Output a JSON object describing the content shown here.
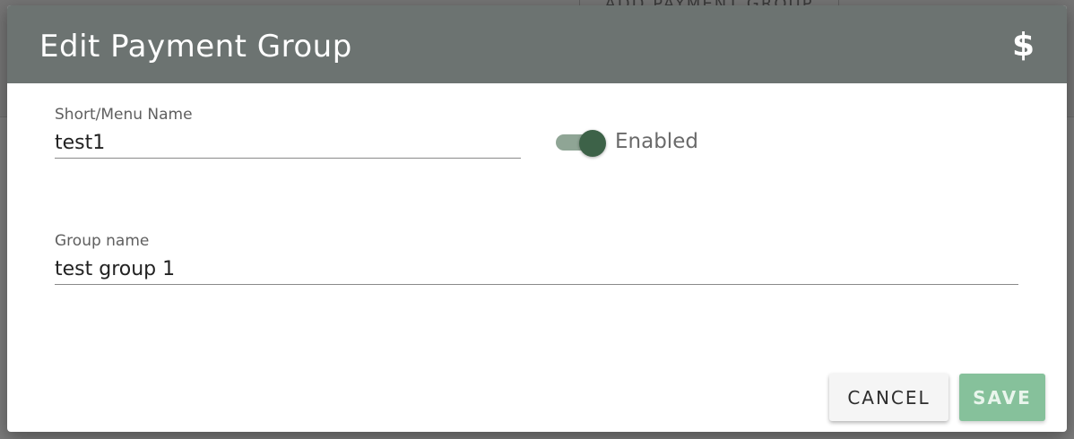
{
  "background": {
    "button_label": "ADD PAYMENT GROUP"
  },
  "modal": {
    "title": "Edit Payment Group",
    "header_icon": "dollar-icon",
    "header_icon_glyph": "$",
    "header_color": "#6c7371"
  },
  "form": {
    "short_name": {
      "label": "Short/Menu Name",
      "value": "test1"
    },
    "enabled": {
      "label": "Enabled",
      "checked": true,
      "accent_color": "#3d6248"
    },
    "group_name": {
      "label": "Group name",
      "value": "test group 1"
    }
  },
  "actions": {
    "cancel_label": "CANCEL",
    "save_label": "SAVE",
    "save_color": "#86c19b"
  }
}
